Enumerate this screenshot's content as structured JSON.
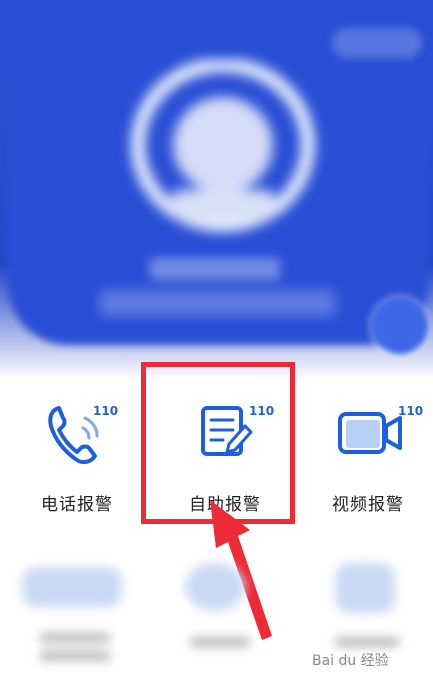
{
  "services": [
    {
      "label": "电话报警",
      "badge": "110",
      "icon": "phone-icon"
    },
    {
      "label": "自助报警",
      "badge": "110",
      "icon": "edit-form-icon"
    },
    {
      "label": "视频报警",
      "badge": "110",
      "icon": "video-camera-icon"
    }
  ],
  "watermark": "Bai du 经验",
  "colors": {
    "accent": "#1d5fe0",
    "banner": "#2a4fd6",
    "highlight": "#ee2a36"
  }
}
